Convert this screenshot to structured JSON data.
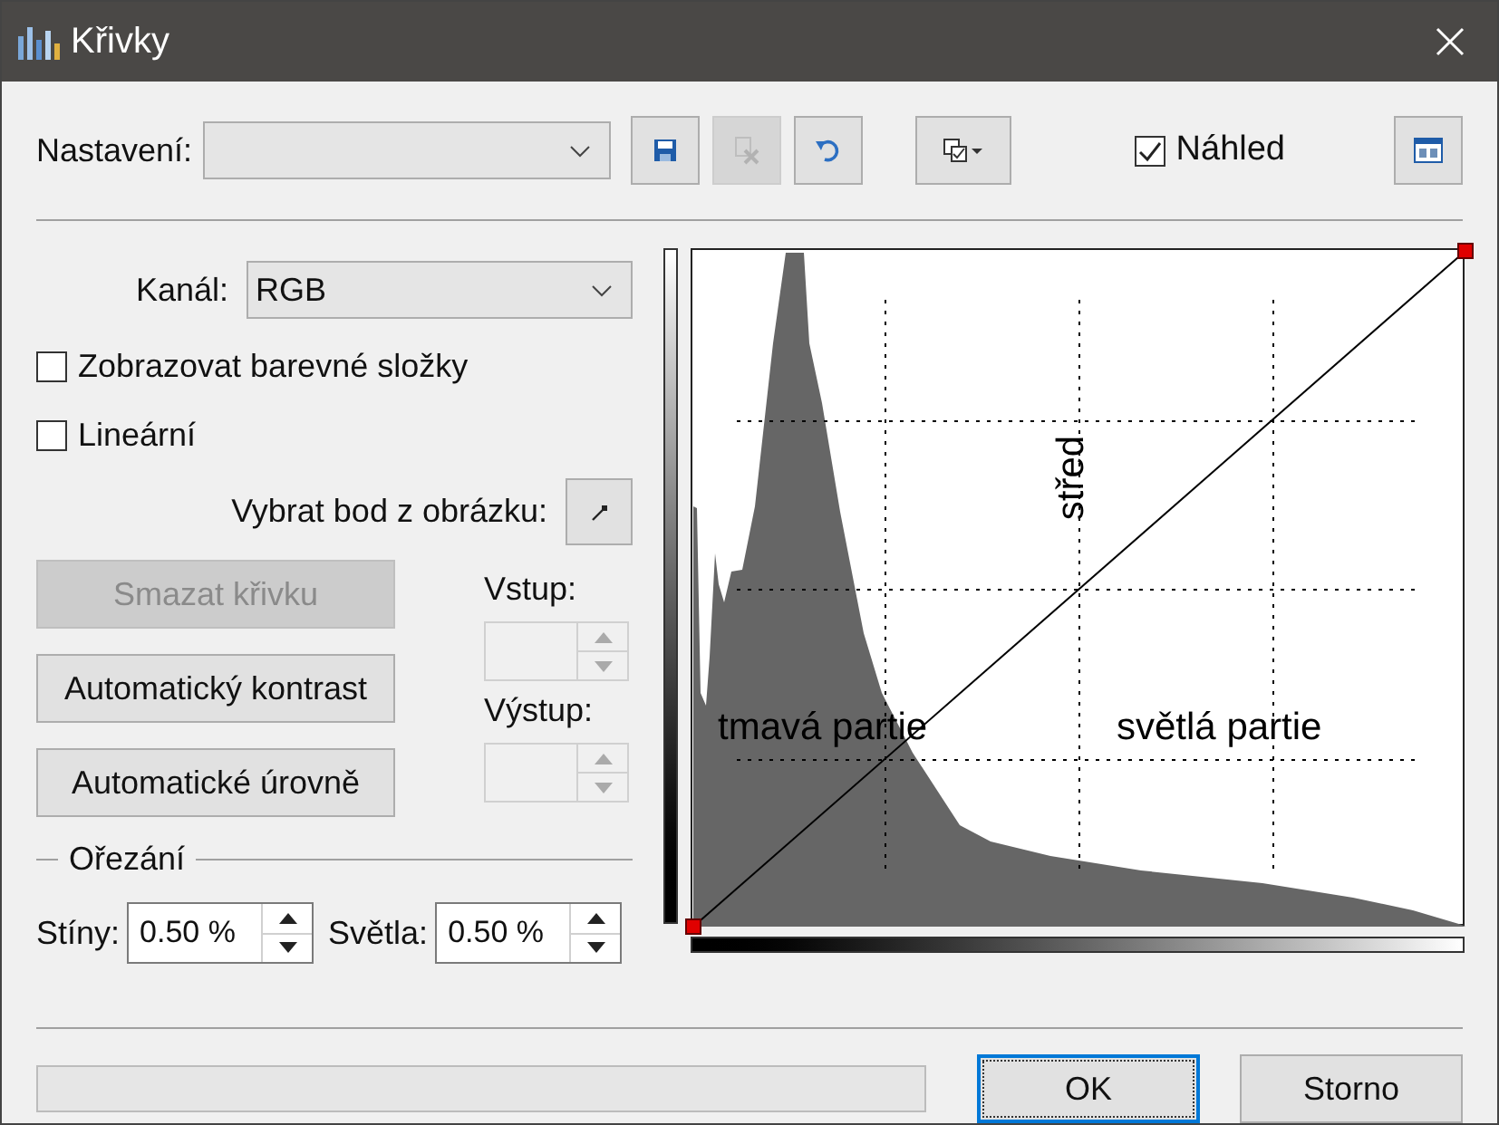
{
  "window": {
    "title": "Křivky"
  },
  "preset": {
    "label": "Nastavení:"
  },
  "toolbar": [
    {
      "kind": "save",
      "disabled": false
    },
    {
      "kind": "delete",
      "disabled": true
    },
    {
      "kind": "undo",
      "disabled": false
    },
    {
      "kind": "options",
      "disabled": false
    }
  ],
  "preview": {
    "label": "Náhled",
    "checked": true
  },
  "channel": {
    "label": "Kanál:",
    "value": "RGB"
  },
  "options": [
    {
      "label": "Zobrazovat barevné složky",
      "checked": false
    },
    {
      "label": "Lineární",
      "checked": false
    }
  ],
  "pick_point": {
    "label": "Vybrat bod z obrázku:"
  },
  "actions": [
    {
      "label": "Smazat křivku",
      "disabled": true
    },
    {
      "label": "Automatický kontrast",
      "disabled": false
    },
    {
      "label": "Automatické úrovně",
      "disabled": false
    }
  ],
  "inputs": [
    {
      "label": "Vstup:",
      "disabled": true
    },
    {
      "label": "Výstup:",
      "disabled": true
    }
  ],
  "clipping": {
    "title": "Ořezání",
    "fields": [
      {
        "label": "Stíny:",
        "value": "0.50 %"
      },
      {
        "label": "Světla:",
        "value": "0.50 %"
      }
    ]
  },
  "graph": {
    "zones": [
      {
        "kind": "dark",
        "label": "tmavá partie"
      },
      {
        "kind": "mid",
        "label": "střed"
      },
      {
        "kind": "light",
        "label": "světlá partie"
      }
    ]
  },
  "footer": {
    "progress": {
      "level": 0
    },
    "buttons": [
      {
        "label": "OK",
        "focused": true
      },
      {
        "label": "Storno",
        "focused": false
      }
    ]
  }
}
